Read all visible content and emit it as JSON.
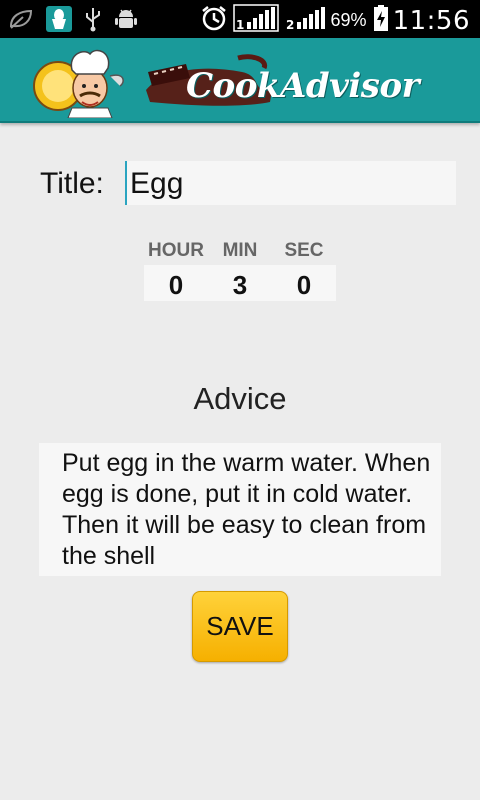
{
  "status_bar": {
    "battery_percent": "69%",
    "time": "11:56",
    "sim1_label": "1",
    "sim2_label": "2",
    "icons": [
      "leaf-icon",
      "egg-app-icon",
      "usb-icon",
      "android-debug-icon",
      "alarm-icon",
      "signal-icon",
      "battery-charging-icon"
    ]
  },
  "header": {
    "brand": "CookAdvisor",
    "logo_icon": "chef-icon"
  },
  "form": {
    "title_label": "Title:",
    "title_value": "Egg"
  },
  "timer": {
    "hour_label": "HOUR",
    "min_label": "MIN",
    "sec_label": "SEC",
    "hour_value": "0",
    "min_value": "3",
    "sec_value": "0"
  },
  "advice": {
    "heading": "Advice",
    "text": "Put egg in the warm water. When egg is done, put it in cold water. Then it will be easy to clean from the shell"
  },
  "actions": {
    "save_label": "SAVE"
  },
  "colors": {
    "appbar": "#1a9a9a",
    "save_button": "#ffc61a",
    "cursor_accent": "#2aa4c0"
  }
}
